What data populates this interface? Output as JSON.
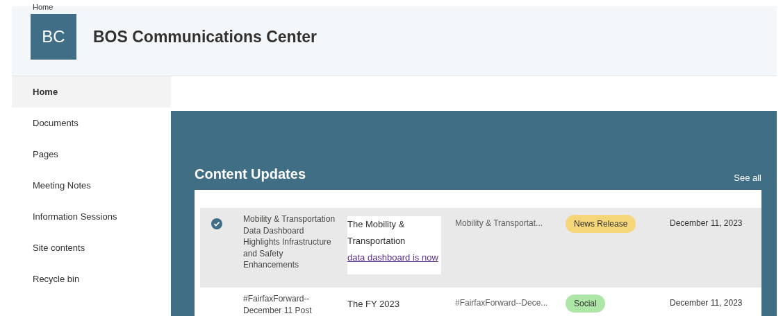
{
  "breadcrumb": "Home",
  "site": {
    "logo": "BC",
    "title": "BOS Communications Center"
  },
  "nav": [
    {
      "label": "Home",
      "selected": true
    },
    {
      "label": "Documents",
      "selected": false
    },
    {
      "label": "Pages",
      "selected": false
    },
    {
      "label": "Meeting Notes",
      "selected": false
    },
    {
      "label": "Information Sessions",
      "selected": false
    },
    {
      "label": "Site contents",
      "selected": false
    },
    {
      "label": "Recycle bin",
      "selected": false
    }
  ],
  "section": {
    "title": "Content Updates",
    "link": "See all"
  },
  "rows": [
    {
      "selected": true,
      "title": "Mobility & Transportation Data Dashboard Highlights Infrastructure and Safety Enhancements",
      "description": "The Mobility & Transportation",
      "description_link": "data dashboard is now",
      "category": "Mobility & Transportat...",
      "tag": "News Release",
      "color": "#f5d77a",
      "date": "December 11, 2023"
    },
    {
      "selected": false,
      "title": "#FairfaxForward--December 11 Post",
      "description": "The FY 2023",
      "category": "#FairfaxForward--Dece...",
      "tag": "Social",
      "color": "#aee6a8",
      "date": "December 11, 2023"
    }
  ]
}
